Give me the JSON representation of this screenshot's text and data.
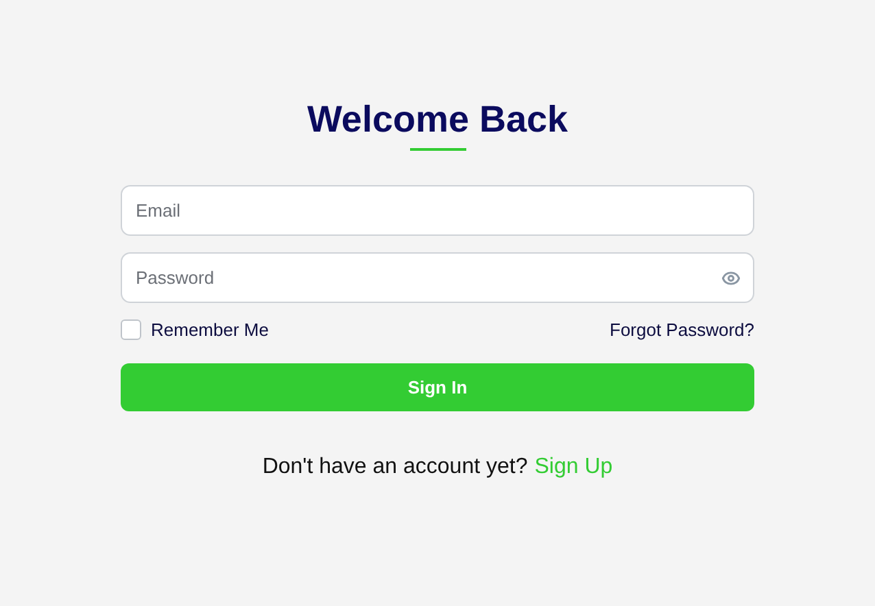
{
  "title": "Welcome Back",
  "fields": [
    {
      "placeholder": "Email",
      "kind": "text"
    },
    {
      "placeholder": "Password",
      "kind": "password"
    }
  ],
  "remember": {
    "label": "Remember Me",
    "checked": false
  },
  "forgot_link": "Forgot Password?",
  "submit_button": "Sign In",
  "footer": {
    "text": "Don't have an account yet?",
    "link": "Sign Up"
  }
}
